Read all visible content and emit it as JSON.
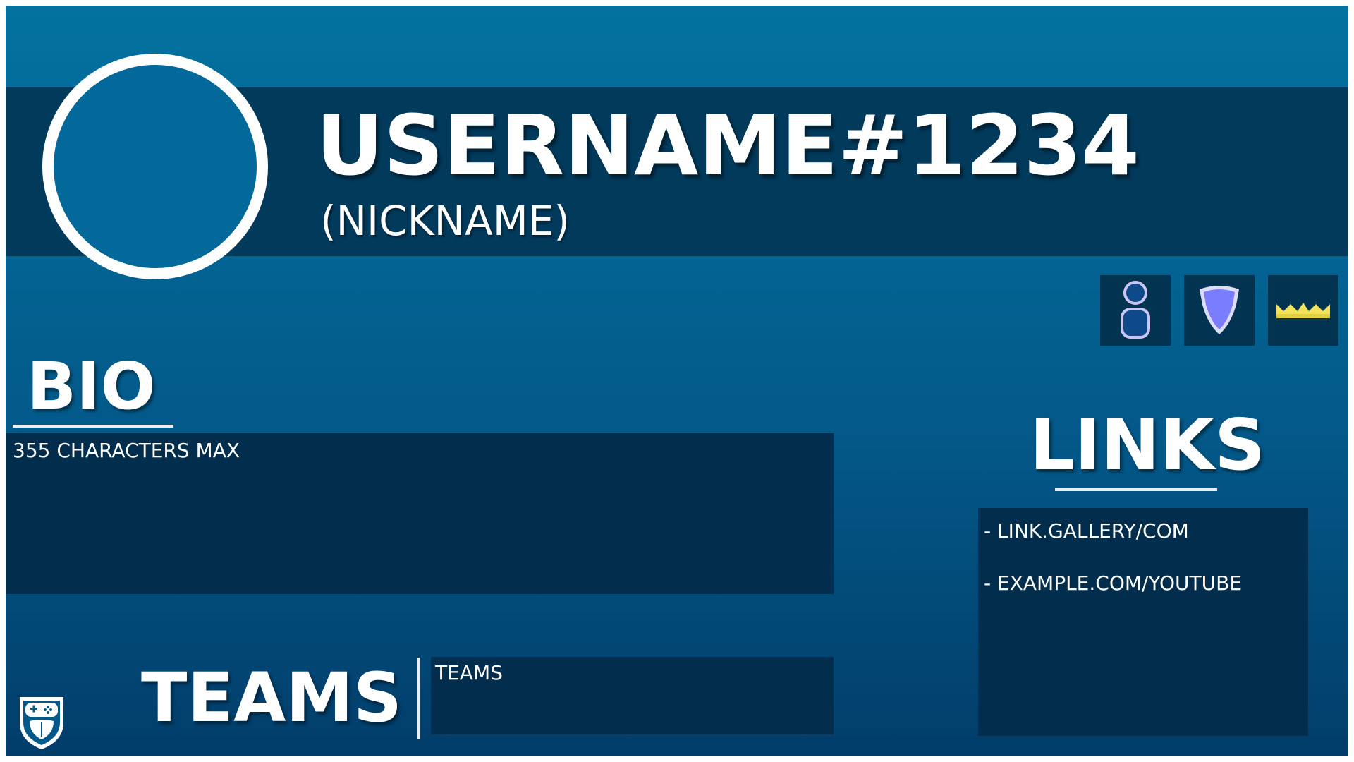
{
  "profile": {
    "username": "USERNAME#1234",
    "nickname": "(NICKNAME)"
  },
  "badges": [
    {
      "icon": "user-icon",
      "color": "#c9c6f5"
    },
    {
      "icon": "shield-icon",
      "color": "#8a8cff"
    },
    {
      "icon": "crown-icon",
      "color": "#f2e35a"
    }
  ],
  "bio": {
    "title": "BIO",
    "text": "355 CHARACTERS MAX"
  },
  "links": {
    "title": "LINKS",
    "items": [
      "- LINK.GALLERY/COM",
      "- EXAMPLE.COM/YOUTUBE"
    ]
  },
  "teams": {
    "title": "TEAMS",
    "text": "TEAMS"
  },
  "logo": {
    "icon": "gamepad-shield-logo-icon"
  },
  "colors": {
    "background_top": "#03729f",
    "background_bottom": "#023d6a",
    "panel": "#022d4c",
    "header_band": "#023a5c",
    "text": "#ffffff"
  }
}
